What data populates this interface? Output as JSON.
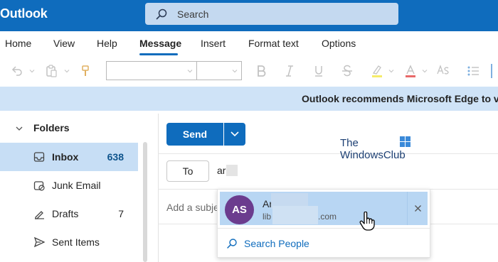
{
  "app": {
    "title": "Outlook"
  },
  "search": {
    "placeholder": "Search"
  },
  "ribbon": {
    "tabs": [
      "Home",
      "View",
      "Help",
      "Message",
      "Insert",
      "Format text",
      "Options"
    ],
    "active_tab": "Message"
  },
  "toolbar": {
    "font_name": "",
    "font_size": "",
    "icons": [
      "undo-icon",
      "paste-icon",
      "format-painter-icon",
      "bold-icon",
      "italic-icon",
      "underline-icon",
      "strikethrough-icon",
      "highlight-icon",
      "font-color-icon",
      "styles-icon",
      "bullets-icon"
    ]
  },
  "banner": {
    "text": "Outlook recommends Microsoft Edge to vie"
  },
  "sidebar": {
    "folders_label": "Folders",
    "items": [
      {
        "label": "Inbox",
        "count": "638",
        "icon": "inbox-icon",
        "selected": true
      },
      {
        "label": "Junk Email",
        "count": "",
        "icon": "junk-icon",
        "selected": false
      },
      {
        "label": "Drafts",
        "count": "7",
        "icon": "drafts-icon",
        "selected": false
      },
      {
        "label": "Sent Items",
        "count": "",
        "icon": "send-icon",
        "selected": false
      }
    ]
  },
  "compose": {
    "send_label": "Send",
    "to_label": "To",
    "to_value": "ar",
    "subject_placeholder": "Add a subje"
  },
  "watermark": {
    "line1": "The",
    "line2": "WindowsClub"
  },
  "suggestions": {
    "person": {
      "initials": "AS",
      "name": "Ar",
      "email_start": "lib",
      "email_end": ".com"
    },
    "search_people_label": "Search People"
  },
  "colors": {
    "brand": "#0f6cbd",
    "banner": "#cfe3f7",
    "selected_folder": "#c7def5",
    "avatar": "#6b3c8e"
  }
}
